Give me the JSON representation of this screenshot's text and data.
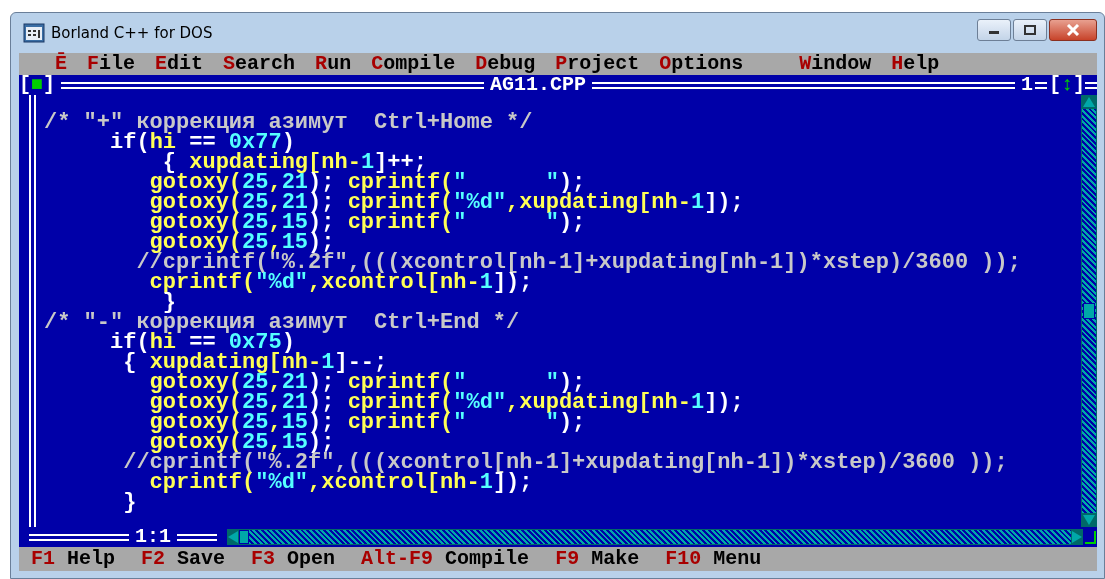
{
  "window": {
    "title": "Borland C++ for DOS"
  },
  "menu": [
    {
      "hotkey": "Ē"
    },
    {
      "hotkey": "F",
      "rest": "ile"
    },
    {
      "hotkey": "E",
      "rest": "dit"
    },
    {
      "hotkey": "S",
      "rest": "earch"
    },
    {
      "hotkey": "R",
      "rest": "un"
    },
    {
      "hotkey": "C",
      "rest": "ompile"
    },
    {
      "hotkey": "D",
      "rest": "ebug"
    },
    {
      "hotkey": "P",
      "rest": "roject"
    },
    {
      "hotkey": "O",
      "rest": "ptions"
    },
    {
      "hotkey": "W",
      "rest": "indow"
    },
    {
      "hotkey": "H",
      "rest": "elp"
    }
  ],
  "editor": {
    "close_box": "[■]",
    "file_name": "AG11.CPP",
    "window_number": "1",
    "zoom_box": "[↕]",
    "cursor_position": "1:1",
    "lines": [
      {
        "segments": [
          {
            "text": "/* \"+\" коррекция азимут  Ctrl+Home */",
            "kind": "comment"
          }
        ]
      },
      {
        "segments": [
          {
            "text": "     if(",
            "kind": "keyword"
          },
          {
            "text": "hi",
            "kind": "ident"
          },
          {
            "text": " == ",
            "kind": "keyword"
          },
          {
            "text": "0x77",
            "kind": "number"
          },
          {
            "text": ")",
            "kind": "keyword"
          }
        ]
      },
      {
        "segments": [
          {
            "text": "         { ",
            "kind": "keyword"
          },
          {
            "text": "xupdating[nh-",
            "kind": "ident"
          },
          {
            "text": "1",
            "kind": "number"
          },
          {
            "text": "]++;",
            "kind": "keyword"
          }
        ]
      },
      {
        "segments": [
          {
            "text": "        gotoxy(",
            "kind": "ident"
          },
          {
            "text": "25",
            "kind": "number"
          },
          {
            "text": ",",
            "kind": "ident"
          },
          {
            "text": "21",
            "kind": "number"
          },
          {
            "text": "); ",
            "kind": "keyword"
          },
          {
            "text": "cprintf(",
            "kind": "ident"
          },
          {
            "text": "\"      \"",
            "kind": "number"
          },
          {
            "text": ");",
            "kind": "keyword"
          }
        ]
      },
      {
        "segments": [
          {
            "text": "        gotoxy(",
            "kind": "ident"
          },
          {
            "text": "25",
            "kind": "number"
          },
          {
            "text": ",",
            "kind": "ident"
          },
          {
            "text": "21",
            "kind": "number"
          },
          {
            "text": "); ",
            "kind": "keyword"
          },
          {
            "text": "cprintf(",
            "kind": "ident"
          },
          {
            "text": "\"%d\"",
            "kind": "number"
          },
          {
            "text": ",xupdating[nh-",
            "kind": "ident"
          },
          {
            "text": "1",
            "kind": "number"
          },
          {
            "text": "]);",
            "kind": "keyword"
          }
        ]
      },
      {
        "segments": [
          {
            "text": "        gotoxy(",
            "kind": "ident"
          },
          {
            "text": "25",
            "kind": "number"
          },
          {
            "text": ",",
            "kind": "ident"
          },
          {
            "text": "15",
            "kind": "number"
          },
          {
            "text": "); ",
            "kind": "keyword"
          },
          {
            "text": "cprintf(",
            "kind": "ident"
          },
          {
            "text": "\"      \"",
            "kind": "number"
          },
          {
            "text": ");",
            "kind": "keyword"
          }
        ]
      },
      {
        "segments": [
          {
            "text": "        gotoxy(",
            "kind": "ident"
          },
          {
            "text": "25",
            "kind": "number"
          },
          {
            "text": ",",
            "kind": "ident"
          },
          {
            "text": "15",
            "kind": "number"
          },
          {
            "text": ");",
            "kind": "keyword"
          }
        ]
      },
      {
        "segments": [
          {
            "text": "       //cprintf(\"%.2f\",(((xcontrol[nh-1]+xupdating[nh-1])*xstep)/3600 ));",
            "kind": "comment"
          }
        ]
      },
      {
        "segments": [
          {
            "text": "        cprintf(",
            "kind": "ident"
          },
          {
            "text": "\"%d\"",
            "kind": "number"
          },
          {
            "text": ",xcontrol[nh-",
            "kind": "ident"
          },
          {
            "text": "1",
            "kind": "number"
          },
          {
            "text": "]);",
            "kind": "keyword"
          }
        ]
      },
      {
        "segments": [
          {
            "text": "         }",
            "kind": "keyword"
          }
        ]
      },
      {
        "segments": [
          {
            "text": "/* \"-\" коррекция азимут  Ctrl+End */",
            "kind": "comment"
          }
        ]
      },
      {
        "segments": [
          {
            "text": "     if(",
            "kind": "keyword"
          },
          {
            "text": "hi",
            "kind": "ident"
          },
          {
            "text": " == ",
            "kind": "keyword"
          },
          {
            "text": "0x75",
            "kind": "number"
          },
          {
            "text": ")",
            "kind": "keyword"
          }
        ]
      },
      {
        "segments": [
          {
            "text": "      { ",
            "kind": "keyword"
          },
          {
            "text": "xupdating[nh-",
            "kind": "ident"
          },
          {
            "text": "1",
            "kind": "number"
          },
          {
            "text": "]--;",
            "kind": "keyword"
          }
        ]
      },
      {
        "segments": [
          {
            "text": "        gotoxy(",
            "kind": "ident"
          },
          {
            "text": "25",
            "kind": "number"
          },
          {
            "text": ",",
            "kind": "ident"
          },
          {
            "text": "21",
            "kind": "number"
          },
          {
            "text": "); ",
            "kind": "keyword"
          },
          {
            "text": "cprintf(",
            "kind": "ident"
          },
          {
            "text": "\"      \"",
            "kind": "number"
          },
          {
            "text": ");",
            "kind": "keyword"
          }
        ]
      },
      {
        "segments": [
          {
            "text": "        gotoxy(",
            "kind": "ident"
          },
          {
            "text": "25",
            "kind": "number"
          },
          {
            "text": ",",
            "kind": "ident"
          },
          {
            "text": "21",
            "kind": "number"
          },
          {
            "text": "); ",
            "kind": "keyword"
          },
          {
            "text": "cprintf(",
            "kind": "ident"
          },
          {
            "text": "\"%d\"",
            "kind": "number"
          },
          {
            "text": ",xupdating[nh-",
            "kind": "ident"
          },
          {
            "text": "1",
            "kind": "number"
          },
          {
            "text": "]);",
            "kind": "keyword"
          }
        ]
      },
      {
        "segments": [
          {
            "text": "        gotoxy(",
            "kind": "ident"
          },
          {
            "text": "25",
            "kind": "number"
          },
          {
            "text": ",",
            "kind": "ident"
          },
          {
            "text": "15",
            "kind": "number"
          },
          {
            "text": "); ",
            "kind": "keyword"
          },
          {
            "text": "cprintf(",
            "kind": "ident"
          },
          {
            "text": "\"      \"",
            "kind": "number"
          },
          {
            "text": ");",
            "kind": "keyword"
          }
        ]
      },
      {
        "segments": [
          {
            "text": "        gotoxy(",
            "kind": "ident"
          },
          {
            "text": "25",
            "kind": "number"
          },
          {
            "text": ",",
            "kind": "ident"
          },
          {
            "text": "15",
            "kind": "number"
          },
          {
            "text": ");",
            "kind": "keyword"
          }
        ]
      },
      {
        "segments": [
          {
            "text": "      //cprintf(\"%.2f\",(((xcontrol[nh-1]+xupdating[nh-1])*xstep)/3600 ));",
            "kind": "comment"
          }
        ]
      },
      {
        "segments": [
          {
            "text": "        cprintf(",
            "kind": "ident"
          },
          {
            "text": "\"%d\"",
            "kind": "number"
          },
          {
            "text": ",xcontrol[nh-",
            "kind": "ident"
          },
          {
            "text": "1",
            "kind": "number"
          },
          {
            "text": "]);",
            "kind": "keyword"
          }
        ]
      },
      {
        "segments": [
          {
            "text": "      }",
            "kind": "keyword"
          }
        ]
      }
    ]
  },
  "status_bar": [
    {
      "key": "F1",
      "label": "Help"
    },
    {
      "key": "F2",
      "label": "Save"
    },
    {
      "key": "F3",
      "label": "Open"
    },
    {
      "key": "Alt-F9",
      "label": "Compile"
    },
    {
      "key": "F9",
      "label": "Make"
    },
    {
      "key": "F10",
      "label": "Menu"
    }
  ]
}
